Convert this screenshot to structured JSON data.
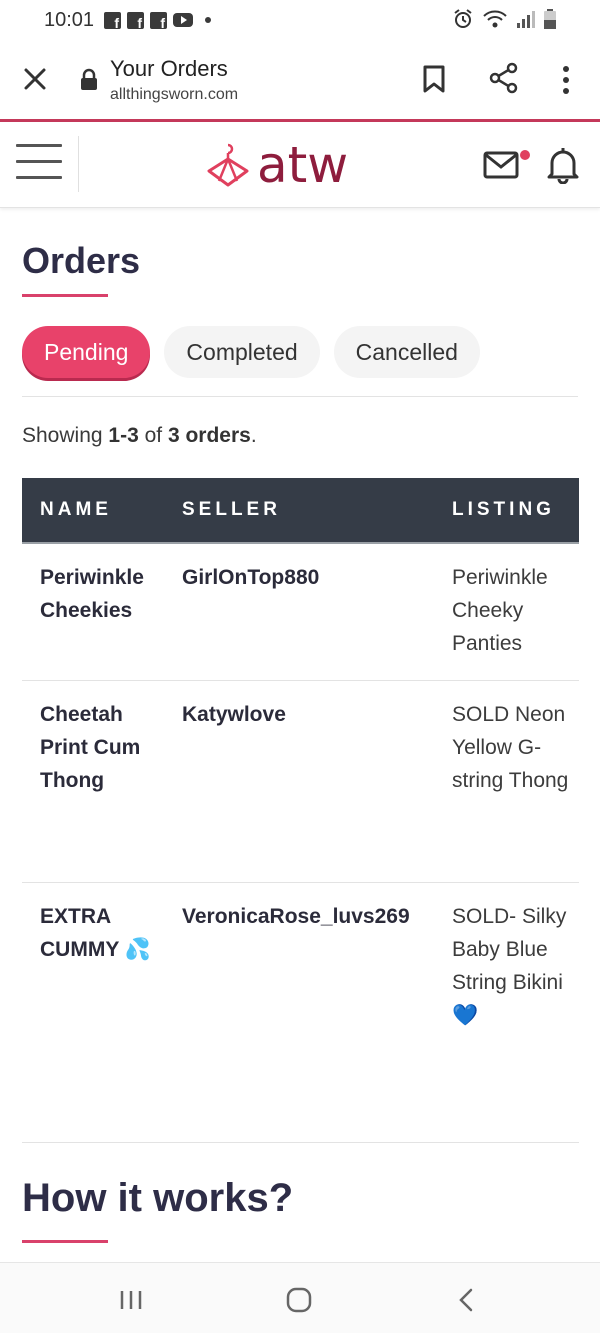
{
  "status_bar": {
    "time": "10:01"
  },
  "browser": {
    "title": "Your Orders",
    "domain": "allthingsworn.com"
  },
  "header": {
    "logo_text": "atw"
  },
  "page": {
    "title": "Orders",
    "tabs": [
      {
        "label": "Pending",
        "active": true
      },
      {
        "label": "Completed",
        "active": false
      },
      {
        "label": "Cancelled",
        "active": false
      }
    ],
    "showing": {
      "prefix": "Showing ",
      "range": "1-3",
      "middle": " of ",
      "count": "3 orders",
      "suffix": "."
    }
  },
  "table": {
    "headers": [
      "NAME",
      "SELLER",
      "LISTING"
    ],
    "rows": [
      {
        "name": "Periwinkle Cheekies",
        "seller": "GirlOnTop880",
        "listing": "Periwinkle Cheeky Panties"
      },
      {
        "name": "Cheetah Print Cum Thong",
        "seller": "Katywlove",
        "listing": "SOLD Neon Yellow G-string Thong"
      },
      {
        "name": "EXTRA CUMMY 💦",
        "seller": "VeronicaRose_luvs269",
        "listing": "SOLD- Silky Baby Blue String Bikini 💙"
      }
    ]
  },
  "how_it_works": {
    "title": "How it works?"
  },
  "colors": {
    "accent": "#e8426a",
    "brand": "#8e1d3d",
    "table_header": "#353c47"
  }
}
